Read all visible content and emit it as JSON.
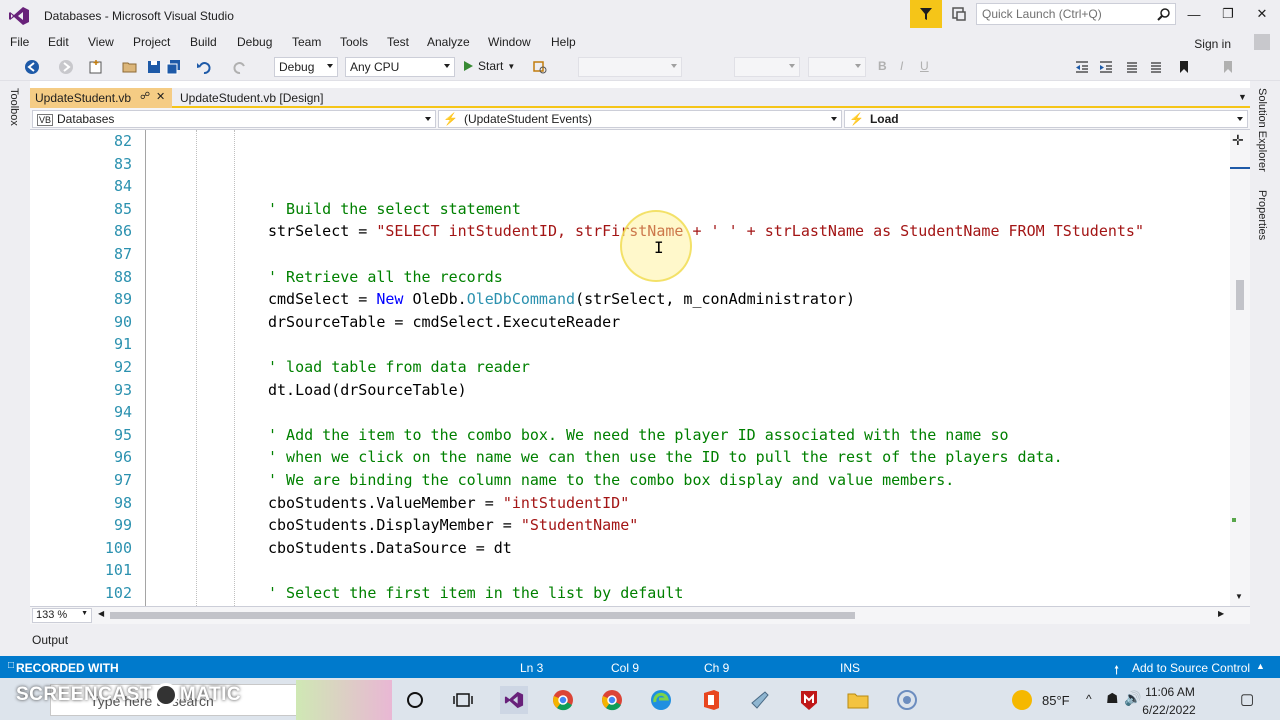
{
  "window": {
    "title": "Databases - Microsoft Visual Studio",
    "quick_launch_placeholder": "Quick Launch (Ctrl+Q)"
  },
  "menu": {
    "items": [
      "File",
      "Edit",
      "View",
      "Project",
      "Build",
      "Debug",
      "Team",
      "Tools",
      "Test",
      "Analyze",
      "Window",
      "Help"
    ],
    "signin": "Sign in"
  },
  "toolbar": {
    "config": "Debug",
    "platform": "Any CPU",
    "start": "Start"
  },
  "side": {
    "toolbox": "Toolbox",
    "solution_explorer": "Solution Explorer",
    "properties": "Properties"
  },
  "tabs": {
    "active": "UpdateStudent.vb",
    "second": "UpdateStudent.vb [Design]"
  },
  "nav": {
    "project": "Databases",
    "object": "(UpdateStudent Events)",
    "method": "Load"
  },
  "editor": {
    "lines": [
      {
        "n": "82",
        "parts": []
      },
      {
        "n": "83",
        "parts": []
      },
      {
        "n": "84",
        "parts": []
      },
      {
        "n": "85",
        "parts": [
          {
            "t": "' Build the select statement",
            "c": "cmt"
          }
        ]
      },
      {
        "n": "86",
        "parts": [
          {
            "t": "strSelect = ",
            "c": ""
          },
          {
            "t": "\"SELECT intStudentID, strFirstName + ' ' + strLastName as StudentName FROM TStudents\"",
            "c": "str"
          }
        ]
      },
      {
        "n": "87",
        "parts": []
      },
      {
        "n": "88",
        "parts": [
          {
            "t": "' Retrieve all the records",
            "c": "cmt"
          }
        ]
      },
      {
        "n": "89",
        "parts": [
          {
            "t": "cmdSelect = ",
            "c": ""
          },
          {
            "t": "New",
            "c": "kw"
          },
          {
            "t": " OleDb.",
            "c": ""
          },
          {
            "t": "OleDbCommand",
            "c": "cls"
          },
          {
            "t": "(strSelect, m_conAdministrator)",
            "c": ""
          }
        ]
      },
      {
        "n": "90",
        "parts": [
          {
            "t": "drSourceTable = cmdSelect.ExecuteReader",
            "c": ""
          }
        ]
      },
      {
        "n": "91",
        "parts": []
      },
      {
        "n": "92",
        "parts": [
          {
            "t": "' load table from data reader",
            "c": "cmt"
          }
        ]
      },
      {
        "n": "93",
        "parts": [
          {
            "t": "dt.Load(drSourceTable)",
            "c": ""
          }
        ]
      },
      {
        "n": "94",
        "parts": []
      },
      {
        "n": "95",
        "parts": [
          {
            "t": "' Add the item to the combo box. We need the player ID associated with the name so",
            "c": "cmt"
          }
        ]
      },
      {
        "n": "96",
        "parts": [
          {
            "t": "' when we click on the name we can then use the ID to pull the rest of the players data.",
            "c": "cmt"
          }
        ]
      },
      {
        "n": "97",
        "parts": [
          {
            "t": "' We are binding the column name to the combo box display and value members.",
            "c": "cmt"
          }
        ]
      },
      {
        "n": "98",
        "parts": [
          {
            "t": "cboStudents.ValueMember = ",
            "c": ""
          },
          {
            "t": "\"intStudentID\"",
            "c": "str"
          }
        ]
      },
      {
        "n": "99",
        "parts": [
          {
            "t": "cboStudents.DisplayMember = ",
            "c": ""
          },
          {
            "t": "\"StudentName\"",
            "c": "str"
          }
        ]
      },
      {
        "n": "100",
        "parts": [
          {
            "t": "cboStudents.DataSource = dt",
            "c": ""
          }
        ]
      },
      {
        "n": "101",
        "parts": []
      },
      {
        "n": "102",
        "parts": [
          {
            "t": "' Select the first item in the list by default",
            "c": "cmt"
          }
        ]
      }
    ],
    "zoom": "133 %"
  },
  "output_tab": "Output",
  "status": {
    "watermark_top": "RECORDED WITH",
    "watermark_logo": "SCREENCAST",
    "watermark_logo2": "MATIC",
    "ln": "Ln 3",
    "col": "Col 9",
    "ch": "Ch 9",
    "ins": "INS",
    "source_control": "Add to Source Control"
  },
  "taskbar": {
    "search_placeholder": "Type here to search",
    "temp": "85°F",
    "time": "11:06 AM",
    "date": "6/22/2022"
  },
  "colors": {
    "accent": "#007acc",
    "tab_active": "#f5cc84",
    "comment": "#008000",
    "string": "#a31515",
    "keyword": "#0000ff",
    "type": "#2b91af"
  }
}
